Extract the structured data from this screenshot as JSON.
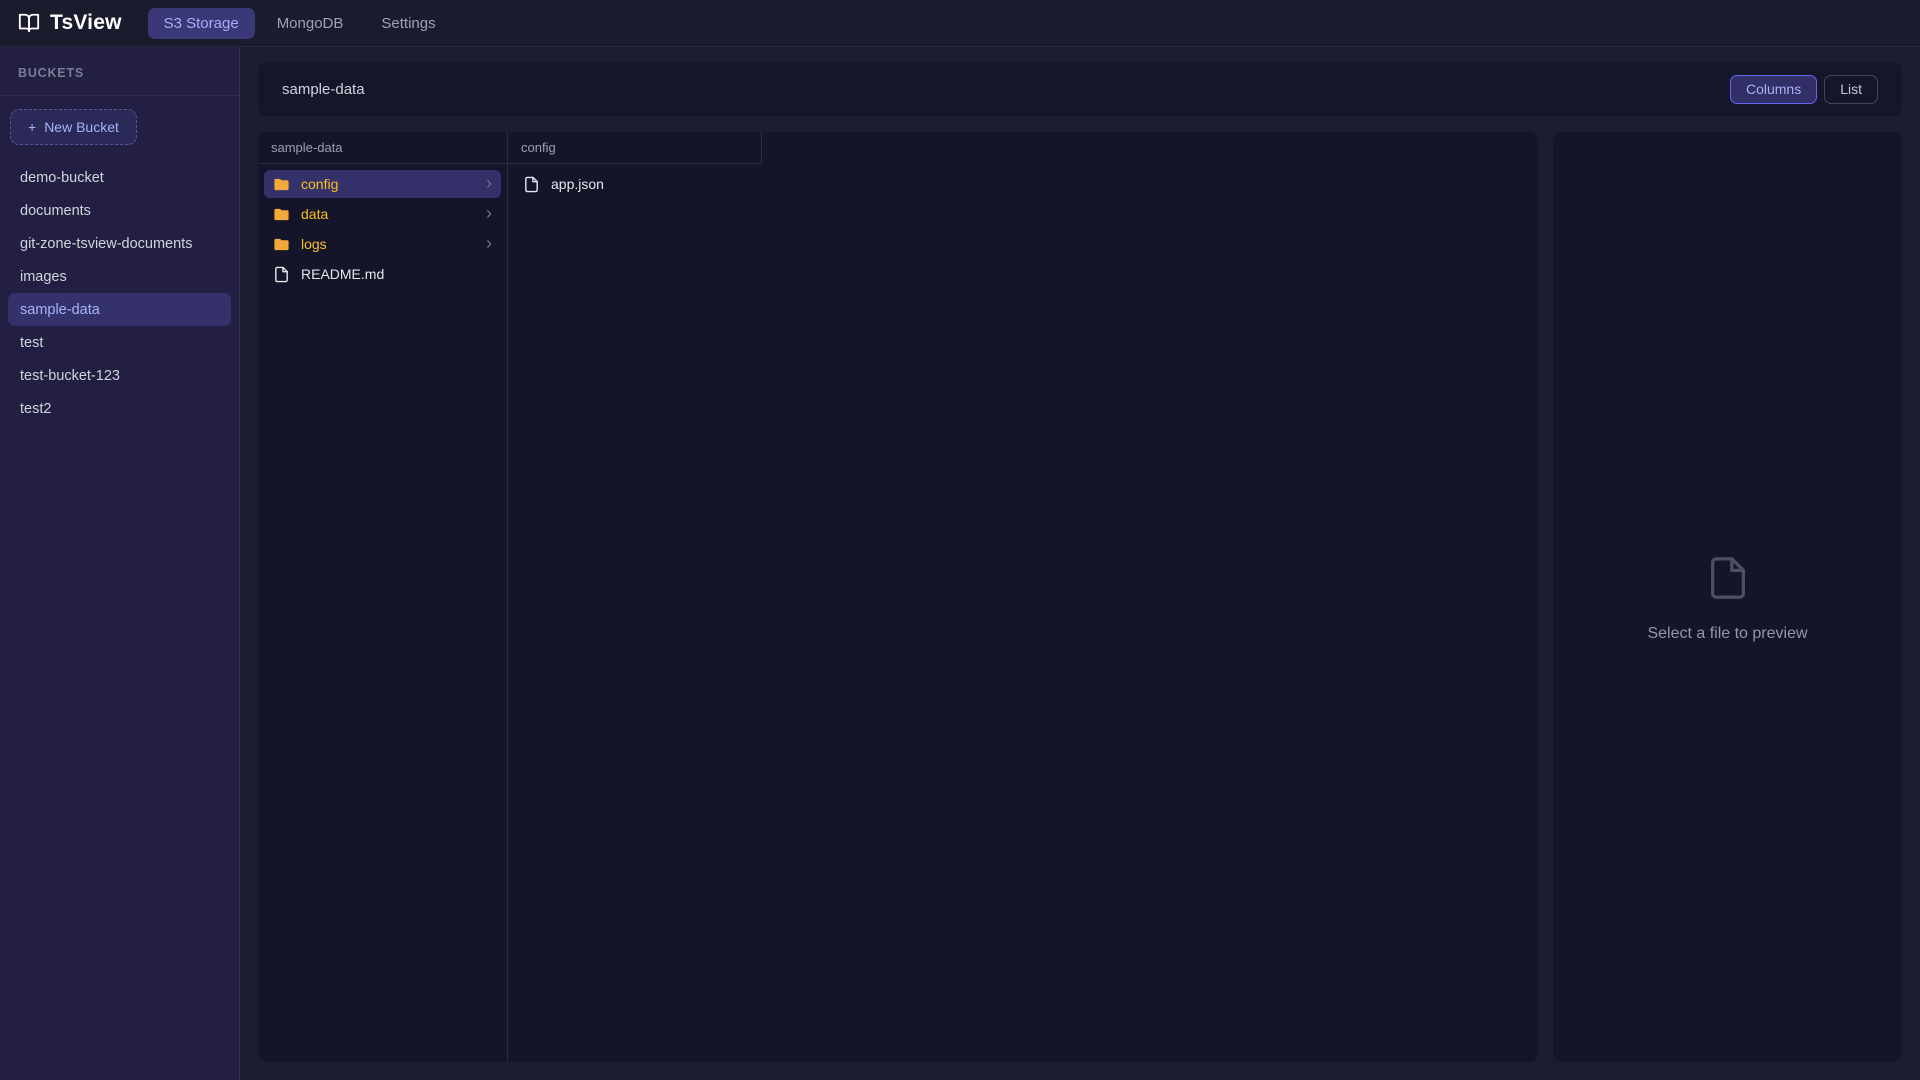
{
  "app": {
    "title": "TsView"
  },
  "nav": {
    "tabs": [
      {
        "label": "S3 Storage"
      },
      {
        "label": "MongoDB"
      },
      {
        "label": "Settings"
      }
    ],
    "active_tab": "S3 Storage"
  },
  "sidebar": {
    "heading": "BUCKETS",
    "new_bucket": {
      "plus": "+",
      "label": "New Bucket"
    },
    "buckets": [
      "demo-bucket",
      "documents",
      "git-zone-tsview-documents",
      "images",
      "sample-data",
      "test",
      "test-bucket-123",
      "test2"
    ],
    "selected_bucket": "sample-data"
  },
  "toolbar": {
    "title": "sample-data",
    "columns_label": "Columns",
    "list_label": "List",
    "active_view": "Columns"
  },
  "browser": {
    "columns": [
      {
        "header": "sample-data",
        "items": [
          {
            "name": "config",
            "type": "folder",
            "selected": true,
            "has_children": true
          },
          {
            "name": "data",
            "type": "folder",
            "selected": false,
            "has_children": true
          },
          {
            "name": "logs",
            "type": "folder",
            "selected": false,
            "has_children": true
          },
          {
            "name": "README.md",
            "type": "file",
            "selected": false,
            "has_children": false
          }
        ]
      },
      {
        "header": "config",
        "items": [
          {
            "name": "app.json",
            "type": "file",
            "selected": false,
            "has_children": false
          }
        ]
      }
    ]
  },
  "preview": {
    "placeholder": "Select a file to preview"
  },
  "icons": {
    "chevron": "›"
  },
  "colors": {
    "accent": "#6366f1",
    "folder": "#fbbf24",
    "selection": "#35316b",
    "topbar_bg": "#1b1b2e",
    "sidebar_bg": "#221f42",
    "panel_bg": "#15152a",
    "main_bg": "#1d1d31"
  }
}
